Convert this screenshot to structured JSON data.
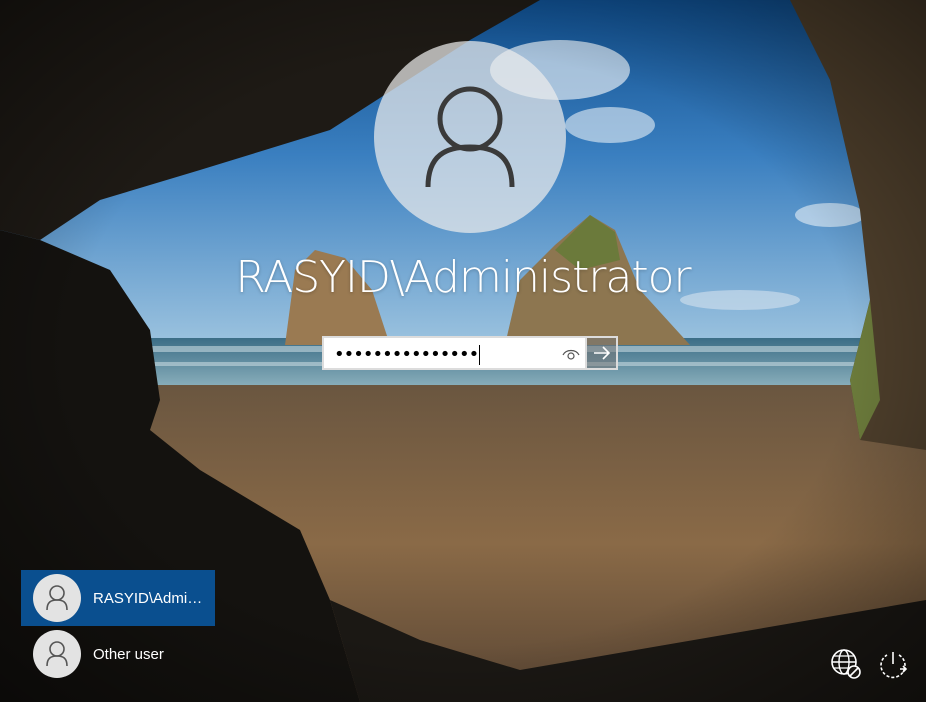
{
  "screen": {
    "username": "RASYID\\Administrator",
    "password_masked": "•••••••••••••••",
    "reveal_icon": "eye-icon",
    "submit_icon": "arrow-right-icon"
  },
  "user_list": [
    {
      "label": "RASYID\\Administrator",
      "display": "RASYID\\Admin...",
      "selected": true
    },
    {
      "label": "Other user",
      "display": "Other user",
      "selected": false
    }
  ],
  "corner_icons": {
    "network": "network-globe-icon",
    "power": "power-icon"
  },
  "colors": {
    "selected_tile": "#0a4f8f",
    "text": "#ffffff"
  }
}
